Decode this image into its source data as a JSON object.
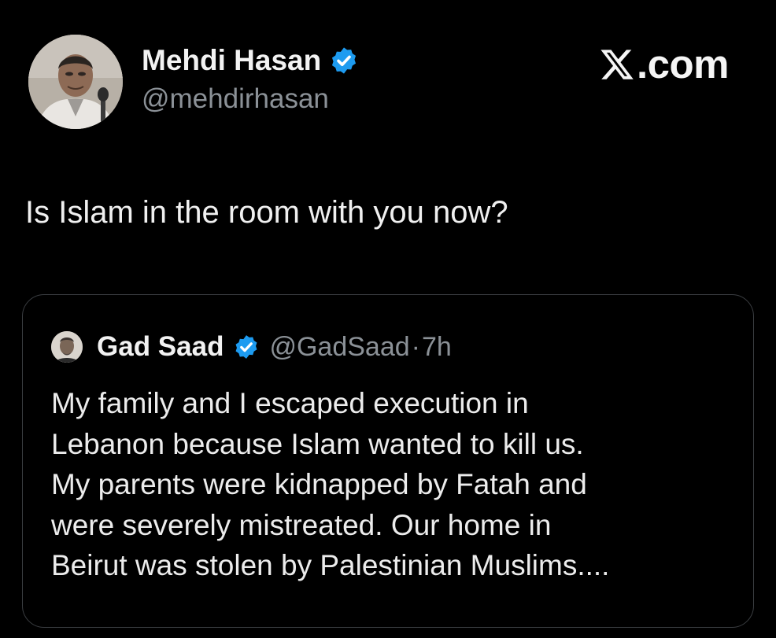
{
  "author": {
    "name": "Mehdi Hasan",
    "handle": "@mehdirhasan",
    "avatar": "person-photo"
  },
  "brand": {
    "label": ".com",
    "icon": "x-logo-icon"
  },
  "tweet": {
    "text": "Is Islam in the room with you now?"
  },
  "quote": {
    "name": "Gad Saad",
    "handle": "@GadSaad",
    "separator": "·",
    "time": "7h",
    "lines": [
      "My family and I escaped execution in",
      "Lebanon because Islam wanted to kill us.",
      "My parents were kidnapped by Fatah and",
      "were severely mistreated.  Our home in",
      "Beirut was stolen by Palestinian Muslims...."
    ]
  },
  "colors": {
    "background": "#000000",
    "verified": "#1d9bf0",
    "secondary_text": "#8b9197",
    "card_border": "#3a3d41"
  }
}
